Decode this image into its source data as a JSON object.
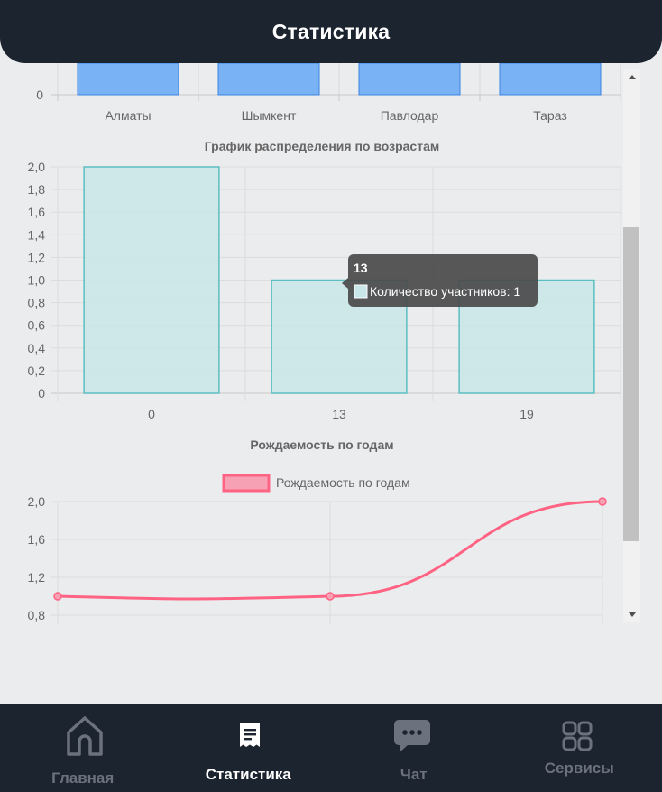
{
  "header": {
    "title": "Статистика"
  },
  "charts": {
    "cities": {
      "type": "bar",
      "categories": [
        "Алматы",
        "Шымкент",
        "Павлодар",
        "Тараз"
      ],
      "y_tick_visible": "0",
      "bar_color": "#7ab3f5",
      "bar_border": "#3b82e0"
    },
    "ages": {
      "title": "График распределения по возрастам",
      "categories": [
        "0",
        "13",
        "19"
      ],
      "y_ticks": [
        "2,0",
        "1,8",
        "1,6",
        "1,4",
        "1,2",
        "1,0",
        "0,8",
        "0,6",
        "0,4",
        "0,2",
        "0"
      ],
      "fill_color": "#c9e6e8",
      "border_color": "#5bbfc2",
      "tooltip": {
        "title": "13",
        "body": "Количество участников: 1"
      }
    },
    "births": {
      "title": "Рождаемость по годам",
      "legend_label": "Рождаемость по годам",
      "y_ticks": [
        "2,0",
        "1,6",
        "1,2",
        "0,8"
      ],
      "line_color": "#ff6384"
    }
  },
  "chart_data": [
    {
      "type": "bar",
      "categories": [
        "Алматы",
        "Шымкент",
        "Павлодар",
        "Тараз"
      ],
      "title": "",
      "xlabel": "",
      "ylabel": ""
    },
    {
      "type": "bar",
      "title": "График распределения по возрастам",
      "categories": [
        "0",
        "13",
        "19"
      ],
      "series": [
        {
          "name": "Количество участников",
          "values": [
            2,
            1,
            1
          ]
        }
      ],
      "ylim": [
        0,
        2
      ],
      "grid": true
    },
    {
      "type": "line",
      "title": "Рождаемость по годам",
      "series": [
        {
          "name": "Рождаемость по годам",
          "values": [
            1,
            1,
            2
          ]
        }
      ],
      "ylim": [
        0.8,
        2.0
      ],
      "legend": "top",
      "grid": true
    }
  ],
  "bottom_nav": {
    "items": [
      {
        "label": "Главная",
        "icon": "home-icon"
      },
      {
        "label": "Статистика",
        "icon": "receipt-icon",
        "active": true
      },
      {
        "label": "Чат",
        "icon": "chat-icon"
      },
      {
        "label": "Сервисы",
        "icon": "grid-icon"
      }
    ]
  }
}
